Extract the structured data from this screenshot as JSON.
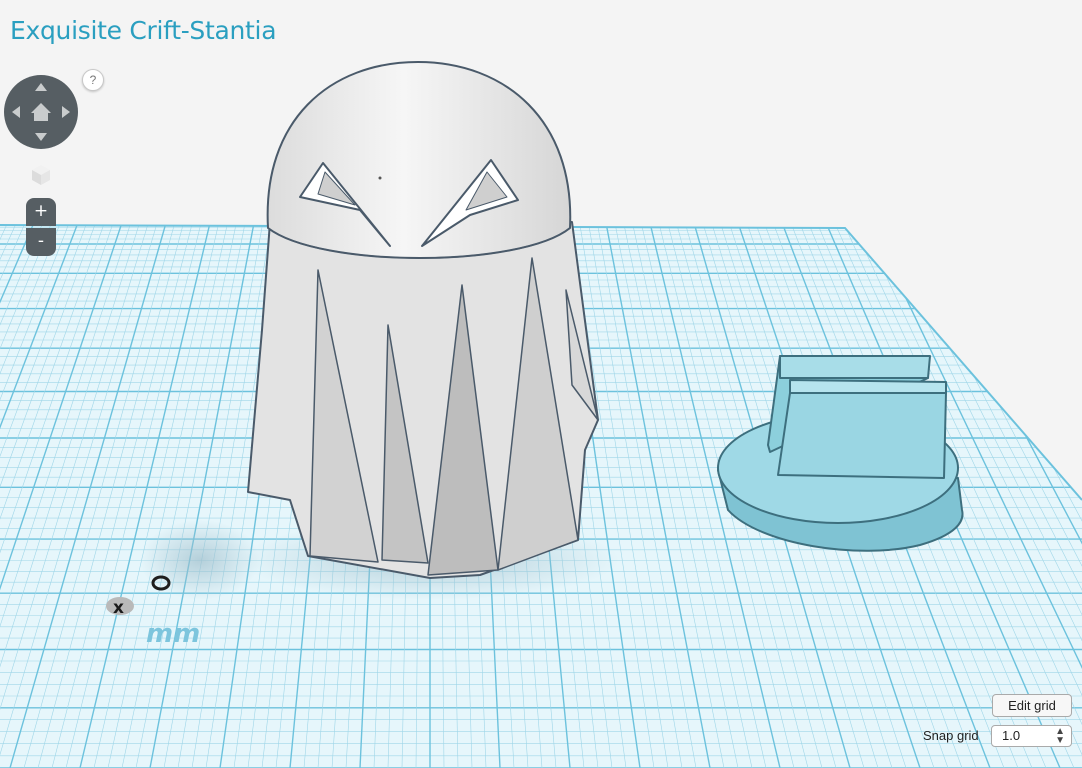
{
  "app": {
    "title": "Exquisite Crift-Stantia"
  },
  "navigation": {
    "help_label": "?",
    "zoom_in_label": "+",
    "zoom_out_label": "-"
  },
  "workplane": {
    "unit_label": "mm",
    "axis_x_label": "x"
  },
  "grid_controls": {
    "edit_grid_label": "Edit grid",
    "snap_grid_label": "Snap grid",
    "snap_grid_value": "1.0"
  },
  "colors": {
    "title": "#2a9fc0",
    "grid_line": "#9fd6e8",
    "grid_major": "#6cc2dd",
    "plane": "#e6f6fb",
    "selected_object": "#8fd3e3",
    "ghost_body": "#eeeeee",
    "control_bg": "#565e63"
  }
}
